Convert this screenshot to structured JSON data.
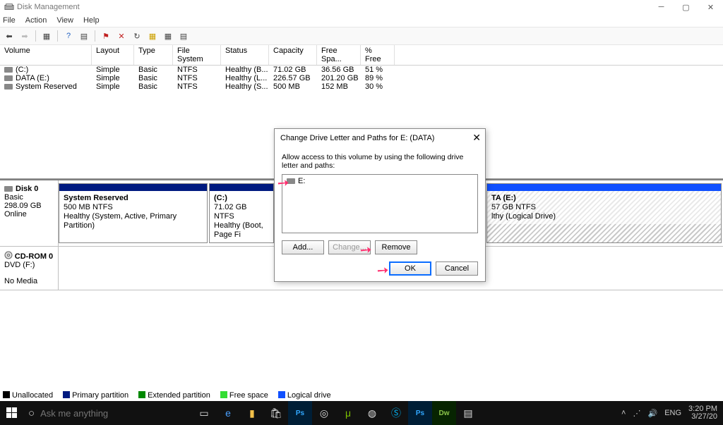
{
  "window": {
    "title": "Disk Management"
  },
  "menu": {
    "file": "File",
    "action": "Action",
    "view": "View",
    "help": "Help"
  },
  "columns": {
    "volume": "Volume",
    "layout": "Layout",
    "type": "Type",
    "fs": "File System",
    "status": "Status",
    "capacity": "Capacity",
    "free": "Free Spa...",
    "pct": "% Free"
  },
  "volumes": [
    {
      "name": "(C:)",
      "layout": "Simple",
      "type": "Basic",
      "fs": "NTFS",
      "status": "Healthy (B...",
      "capacity": "71.02 GB",
      "free": "36.56 GB",
      "pct": "51 %"
    },
    {
      "name": "DATA (E:)",
      "layout": "Simple",
      "type": "Basic",
      "fs": "NTFS",
      "status": "Healthy (L...",
      "capacity": "226.57 GB",
      "free": "201.20 GB",
      "pct": "89 %"
    },
    {
      "name": "System Reserved",
      "layout": "Simple",
      "type": "Basic",
      "fs": "NTFS",
      "status": "Healthy (S...",
      "capacity": "500 MB",
      "free": "152 MB",
      "pct": "30 %"
    }
  ],
  "disk0": {
    "label": "Disk 0",
    "type": "Basic",
    "size": "298.09 GB",
    "state": "Online",
    "p1": {
      "title": "System Reserved",
      "line1": "500 MB NTFS",
      "line2": "Healthy (System, Active, Primary Partition)"
    },
    "p2": {
      "title": "(C:)",
      "line1": "71.02 GB NTFS",
      "line2": "Healthy (Boot, Page Fi"
    },
    "p3": {
      "title": "TA (E:)",
      "line1": "57 GB NTFS",
      "line2": "lthy (Logical Drive)"
    }
  },
  "cdrom": {
    "label": "CD-ROM 0",
    "line1": "DVD (F:)",
    "line2": "No Media"
  },
  "legend": {
    "un": "Unallocated",
    "pp": "Primary partition",
    "ep": "Extended partition",
    "fs": "Free space",
    "ld": "Logical drive"
  },
  "dialog": {
    "title": "Change Drive Letter and Paths for E: (DATA)",
    "subtitle": "Allow access to this volume by using the following drive letter and paths:",
    "item": "E:",
    "add": "Add...",
    "change": "Change...",
    "remove": "Remove",
    "ok": "OK",
    "cancel": "Cancel"
  },
  "taskbar": {
    "search_placeholder": "Ask me anything",
    "time": "3:20 PM",
    "date": "3/27/20",
    "lang": "ENG"
  }
}
